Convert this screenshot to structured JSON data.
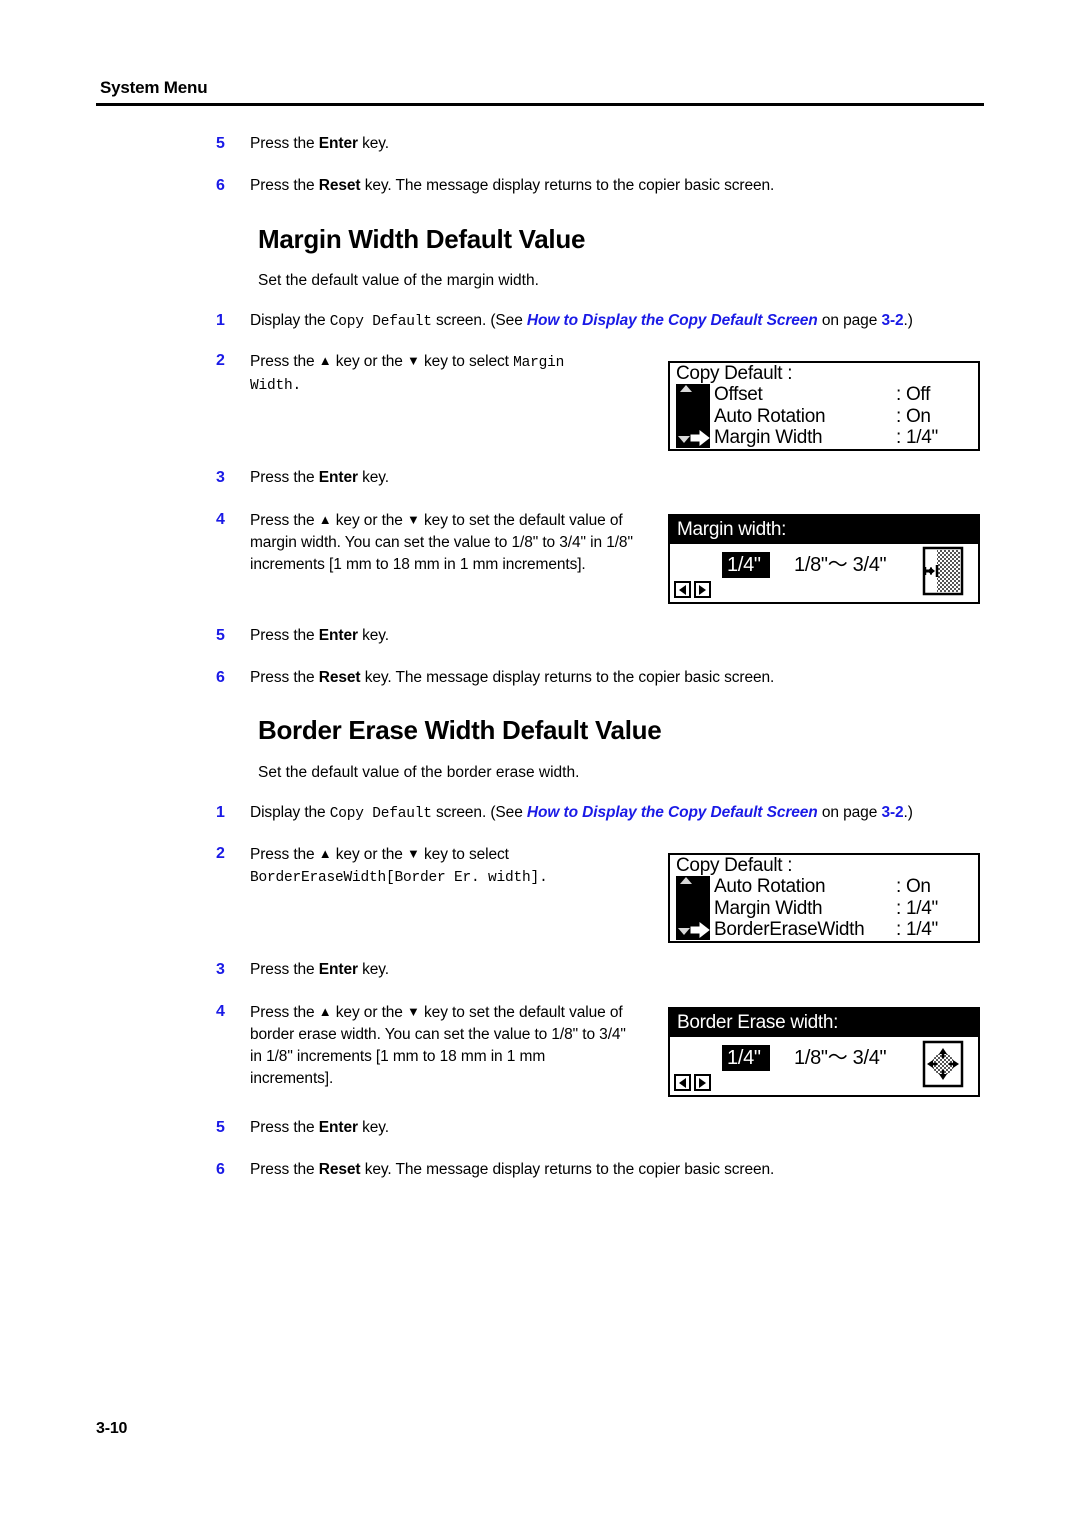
{
  "header": {
    "running_head": "System Menu"
  },
  "folio": "3-10",
  "colors": {
    "accent_blue": "#1a1ae6",
    "text": "#000000",
    "lcd_bg": "#ffffff"
  },
  "top_steps": [
    {
      "num": "5",
      "text_a": "Press the ",
      "bold": "Enter",
      "text_b": " key."
    },
    {
      "num": "6",
      "text_a": "Press the ",
      "bold": "Reset",
      "text_b": " key. The message display returns to the copier basic screen."
    }
  ],
  "section_margin": {
    "heading": "Margin Width Default Value",
    "intro": "Set the default value of the margin width.",
    "step1": {
      "num": "1",
      "pre": "Display the ",
      "mono": "Copy Default",
      "mid": " screen. (See ",
      "xref": "How to Display the Copy Default Screen",
      "mid2": " on page ",
      "xpage": "3-2",
      "post": ".)"
    },
    "step2": {
      "num": "2",
      "pre": "Press the ",
      "up": "▲",
      "mid": " key or the ",
      "down": "▼",
      "post": " key to select ",
      "mono1": "Margin",
      "mono2": "Width",
      "period": "."
    },
    "step3": {
      "num": "3",
      "text_a": "Press the ",
      "bold": "Enter",
      "text_b": " key."
    },
    "step4": {
      "num": "4",
      "pre": "Press the ",
      "up": "▲",
      "mid": " key or the ",
      "down": "▼",
      "post": " key to set the default value of margin width. You can set the value to 1/8\" to 3/4\" in 1/8\" increments [1 mm to 18 mm in 1 mm increments]."
    },
    "step5": {
      "num": "5",
      "text_a": "Press the ",
      "bold": "Enter",
      "text_b": " key."
    },
    "step6": {
      "num": "6",
      "text_a": "Press the ",
      "bold": "Reset",
      "text_b": " key. The message display returns to the copier basic screen."
    }
  },
  "section_border": {
    "heading": "Border Erase Width Default Value",
    "intro": "Set the default value of the border erase width.",
    "step1": {
      "num": "1",
      "pre": "Display the ",
      "mono": "Copy Default",
      "mid": " screen. (See ",
      "xref": "How to Display the Copy Default Screen",
      "mid2": " on page ",
      "xpage": "3-2",
      "post": ".)"
    },
    "step2": {
      "num": "2",
      "pre": "Press the ",
      "up": "▲",
      "mid": " key or the ",
      "down": "▼",
      "post": " key to select ",
      "mono1": "BorderEraseWidth",
      "mono2": "[Border Er. width]",
      "period": "."
    },
    "step3": {
      "num": "3",
      "text_a": "Press the ",
      "bold": "Enter",
      "text_b": " key."
    },
    "step4": {
      "num": "4",
      "pre": "Press the ",
      "up": "▲",
      "mid": " key or the ",
      "down": "▼",
      "post": " key to set the default value of border erase width. You can set the value to 1/8\" to 3/4\" in 1/8\" increments [1 mm to 18 mm in 1 mm increments]."
    },
    "step5": {
      "num": "5",
      "text_a": "Press the ",
      "bold": "Enter",
      "text_b": " key."
    },
    "step6": {
      "num": "6",
      "text_a": "Press the ",
      "bold": "Reset",
      "text_b": " key. The message display returns to the copier basic screen."
    }
  },
  "lcd_copy_default_1": {
    "title": "Copy Default :",
    "rows": [
      {
        "label": "Offset",
        "value": ": Off"
      },
      {
        "label": "Auto Rotation",
        "value": ": On"
      },
      {
        "label": "Margin Width",
        "value": ": 1/4\""
      }
    ],
    "selected_index": 2
  },
  "lcd_margin_width": {
    "title": "Margin width:",
    "value": "1/4\"",
    "range": "1/8\"～ 3/4\"",
    "icon": "margin-page-icon"
  },
  "lcd_copy_default_2": {
    "title": "Copy Default :",
    "rows": [
      {
        "label": "Auto Rotation",
        "value": ": On"
      },
      {
        "label": "Margin Width",
        "value": ": 1/4\""
      },
      {
        "label": "BorderEraseWidth",
        "value": ": 1/4\""
      }
    ],
    "selected_index": 2
  },
  "lcd_border_erase_width": {
    "title": "Border Erase width:",
    "value": "1/4\"",
    "range": "1/8\"～ 3/4\"",
    "icon": "border-erase-icon"
  }
}
